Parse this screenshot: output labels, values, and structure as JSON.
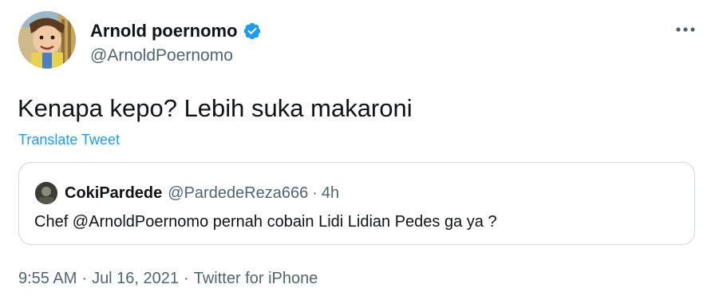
{
  "author": {
    "display_name": "Arnold poernomo",
    "handle": "@ArnoldPoernomo",
    "avatar_icon": "user-avatar",
    "verified": true
  },
  "more_icon": "more-horizontal-icon",
  "tweet": {
    "text": "Kenapa kepo? Lebih suka makaroni",
    "translate_label": "Translate Tweet"
  },
  "quote": {
    "display_name": "CokiPardede",
    "handle": "@PardedeReza666",
    "separator": "·",
    "time": "4h",
    "text": "Chef @ArnoldPoernomo pernah cobain Lidi Lidian Pedes ga ya ?"
  },
  "meta": {
    "time": "9:55 AM",
    "separator": "·",
    "date": "Jul 16, 2021",
    "source": "Twitter for iPhone"
  },
  "colors": {
    "accent": "#1d9bf0",
    "secondary_text": "#536471",
    "border": "#cfd9de"
  }
}
